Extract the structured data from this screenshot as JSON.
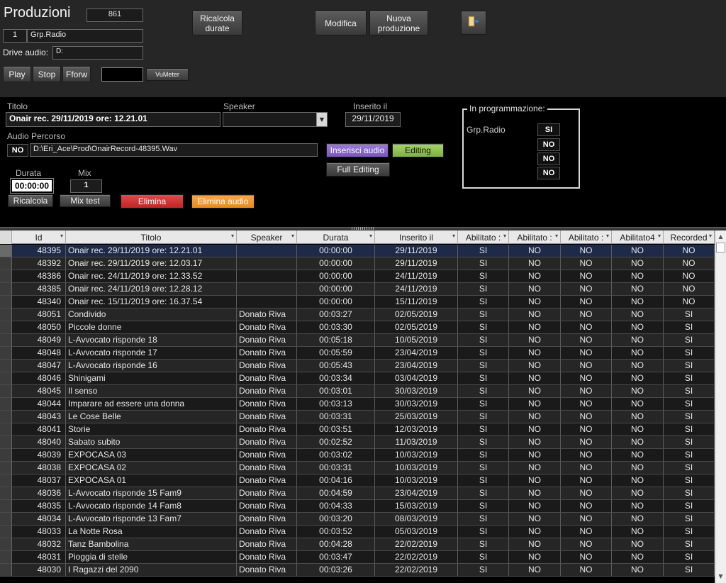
{
  "header": {
    "title": "Produzioni",
    "count": "861",
    "group_id": "1",
    "group_name": "Grp.Radio",
    "drive_label": "Drive audio:",
    "drive_value": "D:"
  },
  "buttons": {
    "ricalcola_durate": "Ricalcola durate",
    "modifica": "Modifica",
    "nuova_produzione": "Nuova produzione",
    "play": "Play",
    "stop": "Stop",
    "fforw": "Fforw",
    "vumeter": "VuMeter",
    "inserisci_audio": "Inserisci audio",
    "editing": "Editing",
    "full_editing": "Full Editing",
    "ricalcola": "Ricalcola",
    "mix_test": "Mix test",
    "elimina": "Elimina",
    "elimina_audio": "Elimina audio"
  },
  "detail": {
    "titolo_label": "Titolo",
    "titolo_value": "Onair rec. 29/11/2019 ore: 12.21.01",
    "speaker_label": "Speaker",
    "speaker_value": "",
    "inserito_label": "Inserito il",
    "inserito_value": "29/11/2019",
    "audio_label": "Audio",
    "percorso_label": "Percorso",
    "audio_flag": "NO",
    "percorso_value": "D:\\Eri_Ace\\Prod\\OnairRecord-48395.Wav",
    "durata_label": "Durata",
    "durata_value": "00:00:00",
    "mix_label": "Mix",
    "mix_value": "1"
  },
  "programmazione": {
    "legend": "In programmazione:",
    "group_label": "Grp.Radio",
    "values": [
      "SI",
      "NO",
      "NO",
      "NO"
    ]
  },
  "grid": {
    "columns": [
      "Id",
      "Titolo",
      "Speaker",
      "Durata",
      "Inserito il",
      "Abilitato :",
      "Abilitato :",
      "Abilitato :",
      "Abilitato4",
      "Recorded"
    ],
    "rows": [
      [
        "48395",
        "Onair rec. 29/11/2019 ore: 12.21.01",
        "",
        "00:00:00",
        "29/11/2019",
        "SI",
        "NO",
        "NO",
        "NO",
        "NO"
      ],
      [
        "48392",
        "Onair rec. 29/11/2019 ore: 12.03.17",
        "",
        "00:00:00",
        "29/11/2019",
        "SI",
        "NO",
        "NO",
        "NO",
        "NO"
      ],
      [
        "48386",
        "Onair rec. 24/11/2019 ore: 12.33.52",
        "",
        "00:00:00",
        "24/11/2019",
        "SI",
        "NO",
        "NO",
        "NO",
        "NO"
      ],
      [
        "48385",
        "Onair rec. 24/11/2019 ore: 12.28.12",
        "",
        "00:00:00",
        "24/11/2019",
        "SI",
        "NO",
        "NO",
        "NO",
        "NO"
      ],
      [
        "48340",
        "Onair rec. 15/11/2019 ore: 16.37.54",
        "",
        "00:00:00",
        "15/11/2019",
        "SI",
        "NO",
        "NO",
        "NO",
        "NO"
      ],
      [
        "48051",
        "Condivido",
        "Donato Riva",
        "00:03:27",
        "02/05/2019",
        "SI",
        "NO",
        "NO",
        "NO",
        "SI"
      ],
      [
        "48050",
        "Piccole donne",
        "Donato Riva",
        "00:03:30",
        "02/05/2019",
        "SI",
        "NO",
        "NO",
        "NO",
        "SI"
      ],
      [
        "48049",
        "L-Avvocato risponde 18",
        "Donato Riva",
        "00:05:18",
        "10/05/2019",
        "SI",
        "NO",
        "NO",
        "NO",
        "SI"
      ],
      [
        "48048",
        "L-Avvocato risponde 17",
        "Donato Riva",
        "00:05:59",
        "23/04/2019",
        "SI",
        "NO",
        "NO",
        "NO",
        "SI"
      ],
      [
        "48047",
        "L-Avvocato risponde 16",
        "Donato Riva",
        "00:05:43",
        "23/04/2019",
        "SI",
        "NO",
        "NO",
        "NO",
        "SI"
      ],
      [
        "48046",
        "Shinigami",
        "Donato Riva",
        "00:03:34",
        "03/04/2019",
        "SI",
        "NO",
        "NO",
        "NO",
        "SI"
      ],
      [
        "48045",
        "Il senso",
        "Donato Riva",
        "00:03:01",
        "30/03/2019",
        "SI",
        "NO",
        "NO",
        "NO",
        "SI"
      ],
      [
        "48044",
        "Imparare ad essere una donna",
        "Donato Riva",
        "00:03:13",
        "30/03/2019",
        "SI",
        "NO",
        "NO",
        "NO",
        "SI"
      ],
      [
        "48043",
        "Le Cose Belle",
        "Donato Riva",
        "00:03:31",
        "25/03/2019",
        "SI",
        "NO",
        "NO",
        "NO",
        "SI"
      ],
      [
        "48041",
        "Storie",
        "Donato Riva",
        "00:03:51",
        "12/03/2019",
        "SI",
        "NO",
        "NO",
        "NO",
        "SI"
      ],
      [
        "48040",
        "Sabato subito",
        "Donato Riva",
        "00:02:52",
        "11/03/2019",
        "SI",
        "NO",
        "NO",
        "NO",
        "SI"
      ],
      [
        "48039",
        "EXPOCASA 03",
        "Donato Riva",
        "00:03:02",
        "10/03/2019",
        "SI",
        "NO",
        "NO",
        "NO",
        "SI"
      ],
      [
        "48038",
        "EXPOCASA 02",
        "Donato Riva",
        "00:03:31",
        "10/03/2019",
        "SI",
        "NO",
        "NO",
        "NO",
        "SI"
      ],
      [
        "48037",
        "EXPOCASA 01",
        "Donato Riva",
        "00:04:16",
        "10/03/2019",
        "SI",
        "NO",
        "NO",
        "NO",
        "SI"
      ],
      [
        "48036",
        "L-Avvocato risponde 15 Fam9",
        "Donato Riva",
        "00:04:59",
        "23/04/2019",
        "SI",
        "NO",
        "NO",
        "NO",
        "SI"
      ],
      [
        "48035",
        "L-Avvocato risponde 14 Fam8",
        "Donato Riva",
        "00:04:33",
        "15/03/2019",
        "SI",
        "NO",
        "NO",
        "NO",
        "SI"
      ],
      [
        "48034",
        "L-Avvocato risponde 13 Fam7",
        "Donato Riva",
        "00:03:20",
        "08/03/2019",
        "SI",
        "NO",
        "NO",
        "NO",
        "SI"
      ],
      [
        "48033",
        "La Notte Rosa",
        "Donato Riva",
        "00:03:52",
        "05/03/2019",
        "SI",
        "NO",
        "NO",
        "NO",
        "SI"
      ],
      [
        "48032",
        "Tanz Bambolina",
        "Donato Riva",
        "00:04:28",
        "22/02/2019",
        "SI",
        "NO",
        "NO",
        "NO",
        "SI"
      ],
      [
        "48031",
        "Pioggia di stelle",
        "Donato Riva",
        "00:03:47",
        "22/02/2019",
        "SI",
        "NO",
        "NO",
        "NO",
        "SI"
      ],
      [
        "48030",
        "I Ragazzi del 2090",
        "Donato Riva",
        "00:03:26",
        "22/02/2019",
        "SI",
        "NO",
        "NO",
        "NO",
        "SI"
      ]
    ]
  },
  "icons": {
    "exit": "exit-door-icon",
    "dropdown": "chevron-down-icon",
    "sort": "sort-arrow-icon"
  },
  "colors": {
    "purple_button": "#8a66cc",
    "green_button": "#8cc24f",
    "red_button": "#d83838",
    "orange_button": "#f09a30"
  }
}
